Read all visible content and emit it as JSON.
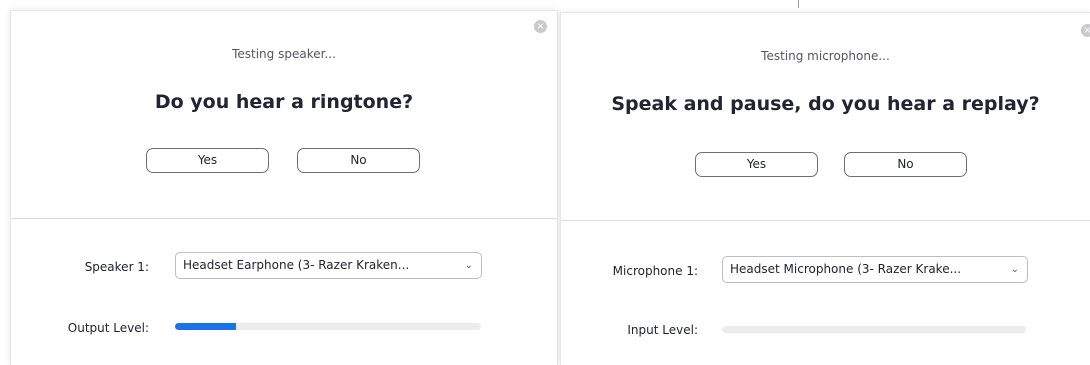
{
  "speaker_test": {
    "status": "Testing speaker...",
    "question": "Do you hear a ringtone?",
    "yes_label": "Yes",
    "no_label": "No",
    "device_label": "Speaker 1:",
    "device_value": "Headset Earphone (3- Razer Kraken...",
    "level_label": "Output Level:",
    "level_fraction": 0.2
  },
  "mic_test": {
    "status": "Testing microphone...",
    "question": "Speak and pause, do you hear a replay?",
    "yes_label": "Yes",
    "no_label": "No",
    "device_label": "Microphone 1:",
    "device_value": "Headset Microphone (3- Razer Krake...",
    "level_label": "Input Level:",
    "level_fraction": 0.0
  },
  "icons": {
    "close": "close-circle-icon",
    "dropdown": "chevron-down-icon"
  },
  "colors": {
    "accent": "#1a73e8",
    "meter_track": "#ececee",
    "close_icon": "#c9c9cf"
  }
}
